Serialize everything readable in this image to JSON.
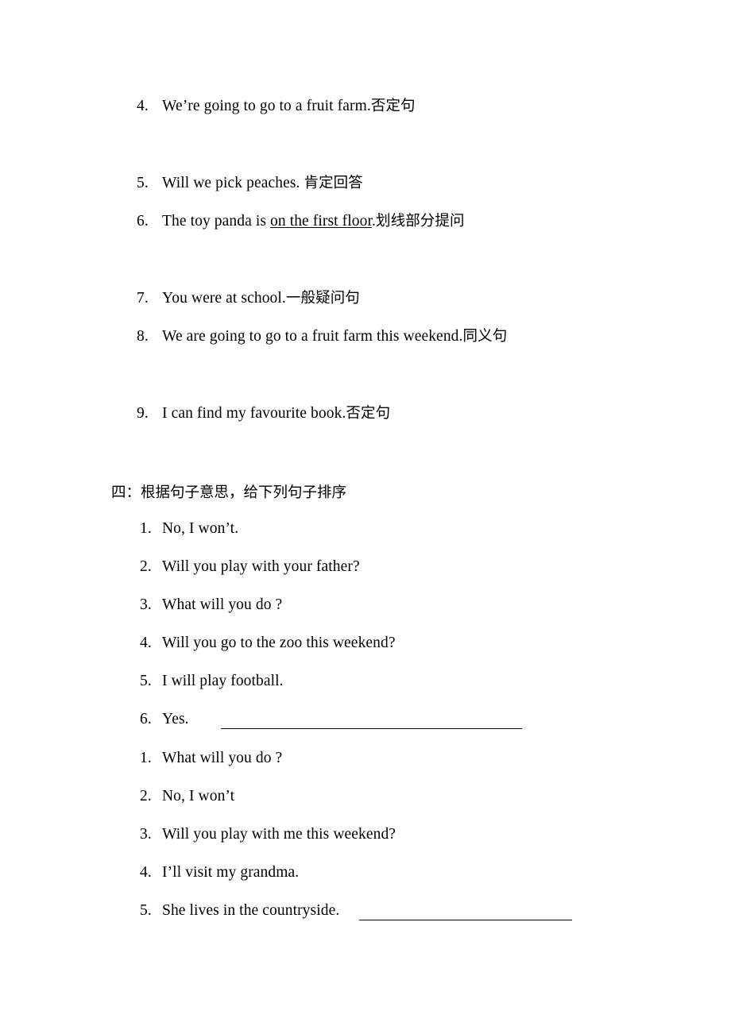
{
  "document": {
    "page_background": "#ffffff",
    "text_color": "#000000",
    "sections": [
      {
        "id": "sentence-transform-exercises",
        "items": [
          {
            "number": "4.",
            "english": "We’re going to go to a fruit farm.",
            "chinese": "否定句",
            "underlined_phrase": "",
            "trailing_blank": false
          },
          {
            "number": "5.",
            "english": "Will we pick peaches. ",
            "chinese": "肯定回答",
            "underlined_phrase": "",
            "trailing_blank": false
          },
          {
            "number": "6.",
            "english_before": "The toy panda is ",
            "underlined_phrase": "on the first floor",
            "english_after": ".",
            "chinese": "划线部分提问",
            "trailing_blank": false
          },
          {
            "number": "7.",
            "english": "You were at school.",
            "chinese": "一般疑问句",
            "underlined_phrase": "",
            "trailing_blank": false
          },
          {
            "number": "8.",
            "english": "We are going to go to a fruit farm this weekend.",
            "chinese": "同义句",
            "underlined_phrase": "",
            "trailing_blank": false
          },
          {
            "number": "9.",
            "english": "I can find my favourite book.",
            "chinese": "否定句",
            "underlined_phrase": "",
            "trailing_blank": false
          }
        ]
      },
      {
        "id": "ordering-exercise",
        "heading": "四：根据句子意思，给下列句子排序",
        "group_one": [
          {
            "number": "1.",
            "english": "No, I won’t.",
            "trailing_blank": false
          },
          {
            "number": "2.",
            "english": "Will you play with your father?",
            "trailing_blank": false
          },
          {
            "number": "3.",
            "english": "What will you do ?",
            "trailing_blank": false
          },
          {
            "number": "4.",
            "english": "Will you go to the zoo this weekend?",
            "trailing_blank": false
          },
          {
            "number": "5.",
            "english": "I will play football.",
            "trailing_blank": false
          },
          {
            "number": "6.",
            "english": "Yes.",
            "trailing_blank": true
          }
        ],
        "group_two": [
          {
            "number": "1.",
            "english": "What will you do ?",
            "trailing_blank": false
          },
          {
            "number": "2.",
            "english": "No, I won’t",
            "trailing_blank": false
          },
          {
            "number": "3.",
            "english": "Will you play with me this weekend?",
            "trailing_blank": false
          },
          {
            "number": "4.",
            "english": "I’ll visit my grandma.",
            "trailing_blank": false
          },
          {
            "number": "5.",
            "english": "She lives in the countryside.",
            "trailing_blank": true
          }
        ]
      }
    ]
  }
}
